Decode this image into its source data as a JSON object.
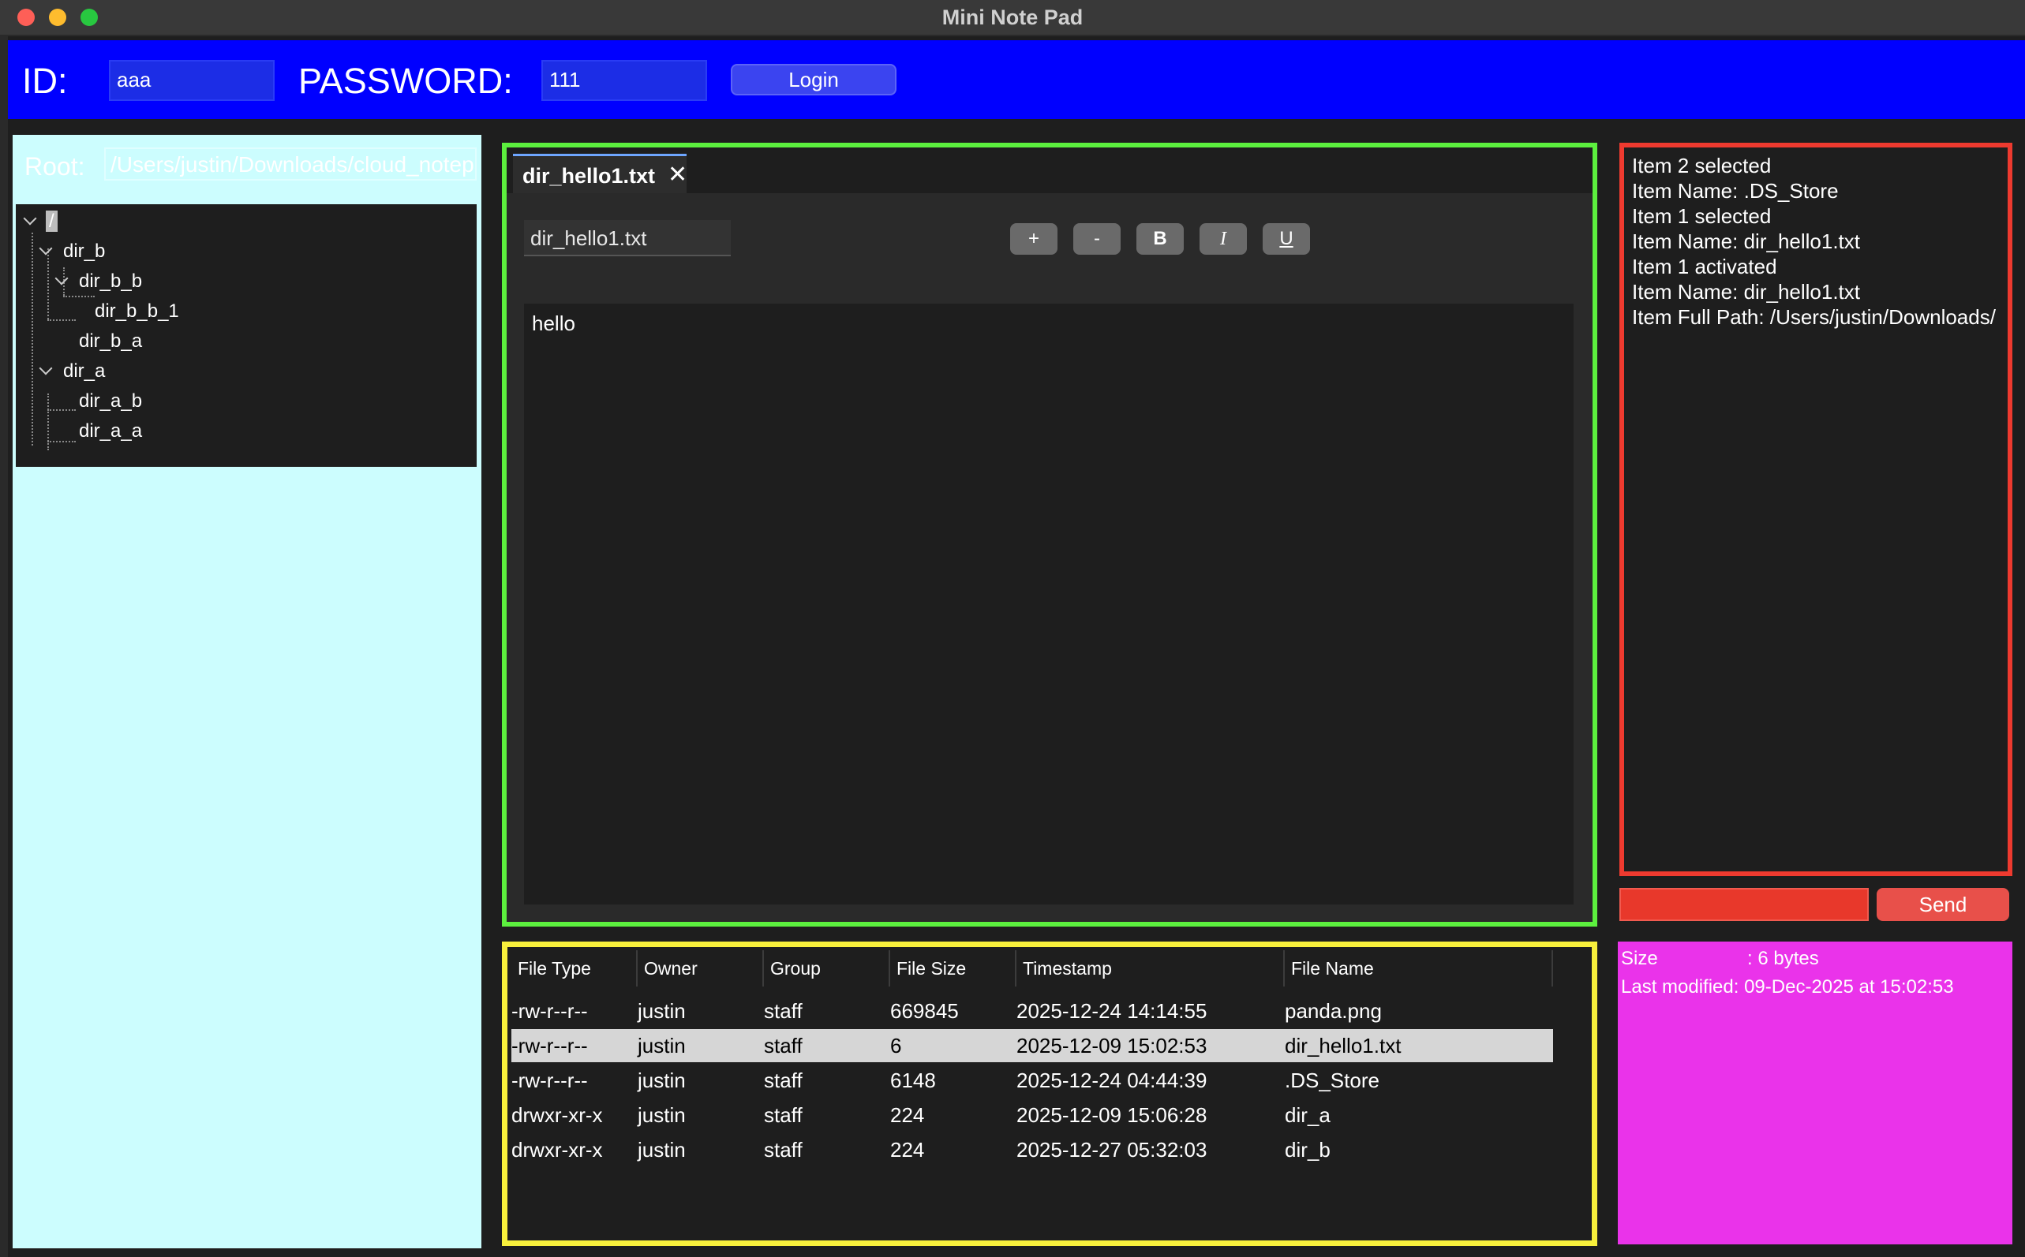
{
  "window": {
    "title": "Mini Note Pad"
  },
  "login": {
    "id_label": "ID:",
    "id_value": "aaa",
    "password_label": "PASSWORD:",
    "password_value": "111",
    "login_button": "Login"
  },
  "explorer": {
    "root_label": "Root:",
    "root_path": "/Users/justin/Downloads/cloud_notepad",
    "tree": {
      "root": "/",
      "dir_b": "dir_b",
      "dir_b_b": "dir_b_b",
      "dir_b_b_1": "dir_b_b_1",
      "dir_b_a": "dir_b_a",
      "dir_a": "dir_a",
      "dir_a_b": "dir_a_b",
      "dir_a_a": "dir_a_a"
    }
  },
  "editor": {
    "tab_label": "dir_hello1.txt",
    "tab_close": "✕",
    "filename": "dir_hello1.txt",
    "buttons": {
      "increase": "+",
      "decrease": "-",
      "bold": "B",
      "italic": "I",
      "underline": "U"
    },
    "content": "hello"
  },
  "file_table": {
    "headers": [
      "File Type",
      "Owner",
      "Group",
      "File Size",
      "Timestamp",
      "File Name"
    ],
    "rows": [
      [
        "-rw-r--r--",
        "justin",
        "staff",
        "669845",
        "2025-12-24 14:14:55",
        "panda.png"
      ],
      [
        "-rw-r--r--",
        "justin",
        "staff",
        "6",
        "2025-12-09 15:02:53",
        "dir_hello1.txt"
      ],
      [
        "-rw-r--r--",
        "justin",
        "staff",
        "6148",
        "2025-12-24 04:44:39",
        ".DS_Store"
      ],
      [
        "drwxr-xr-x",
        "justin",
        "staff",
        "224",
        "2025-12-09 15:06:28",
        "dir_a"
      ],
      [
        "drwxr-xr-x",
        "justin",
        "staff",
        "224",
        "2025-12-27 05:32:03",
        "dir_b"
      ]
    ],
    "selected_row": 1
  },
  "log": {
    "lines": [
      "Item 2 selected",
      "Item Name: .DS_Store",
      "Item 1 selected",
      "Item Name: dir_hello1.txt",
      "Item 1 activated",
      "Item Name: dir_hello1.txt",
      "Item Full Path: /Users/justin/Downloads/"
    ],
    "send_button": "Send"
  },
  "info": {
    "size_line": "Size                 : 6 bytes",
    "modified_line": "Last modified: 09-Dec-2025 at 15:02:53"
  },
  "colors": {
    "login_bar": "#0000ff",
    "explorer_bg": "#ccfdfe",
    "editor_border": "#5cf03e",
    "table_border": "#f8f03c",
    "log_border": "#ee3a2f",
    "info_bg": "#ea33ea"
  }
}
